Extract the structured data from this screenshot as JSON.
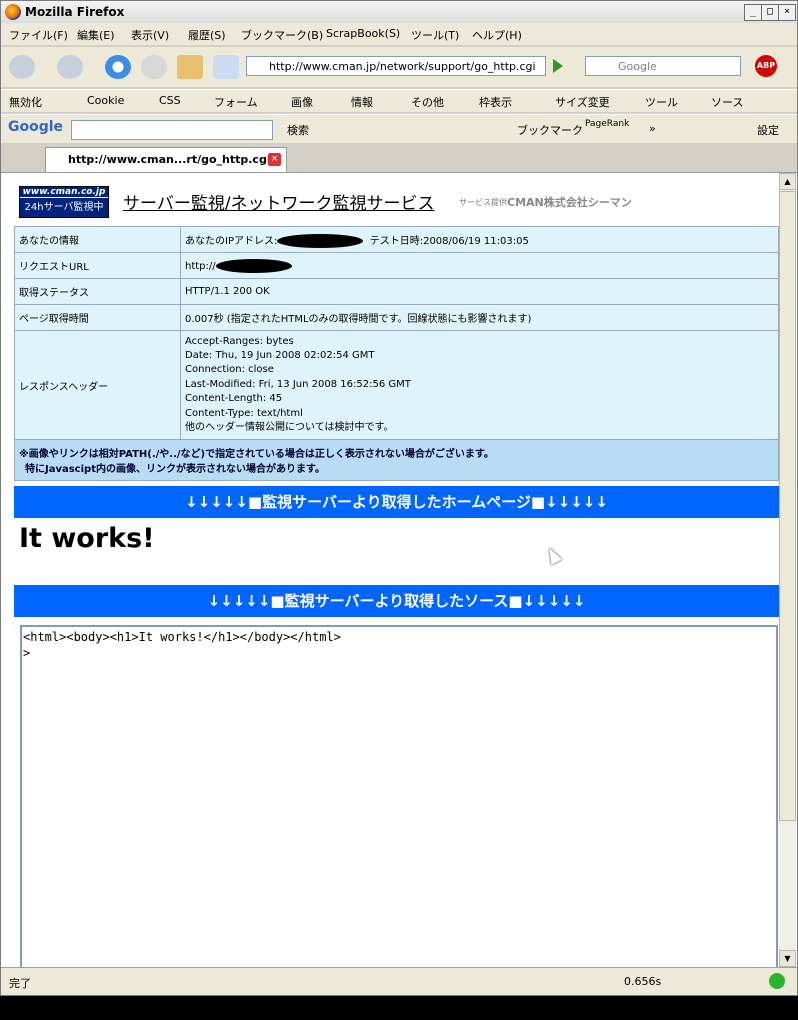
{
  "window": {
    "title": "Mozilla Firefox"
  },
  "menu": [
    "ファイル(F)",
    "編集(E)",
    "表示(V)",
    "履歴(S)",
    "ブックマーク(B)",
    "ScrapBook(S)",
    "ツール(T)",
    "ヘルプ(H)"
  ],
  "nav": {
    "url": "http://www.cman.jp/network/support/go_http.cgi",
    "search_placeholder": "Google"
  },
  "bookmarks": [
    "無効化",
    "Cookie",
    "CSS",
    "フォーム",
    "画像",
    "情報",
    "その他",
    "枠表示",
    "サイズ変更",
    "ツール",
    "ソース"
  ],
  "google_bar": {
    "logo": "Google",
    "search_label": "検索",
    "bookmark_label": "ブックマーク",
    "pagerank_label": "PageRank",
    "more": "»",
    "settings_label": "設定"
  },
  "tab": {
    "title": "http://www.cman...rt/go_http.cgi"
  },
  "page": {
    "logo_top": "www.cman.co.jp",
    "logo_bottom": "24hサーバ監視中",
    "heading": "サーバー監視/ネットワーク監視サービス",
    "provider_prefix": "サービス提供",
    "provider_name": "CMAN株式会社シーマン",
    "rows": {
      "your_info_label": "あなたの情報",
      "ip_label": "あなたのIPアドレス:",
      "test_time": "テスト日時:2008/06/19 11:03:05",
      "request_url_label": "リクエストURL",
      "request_url_prefix": "http://",
      "status_label": "取得ステータス",
      "status_value": "HTTP/1.1 200 OK",
      "time_label": "ページ取得時間",
      "time_value": "0.007秒 (指定されたHTMLのみの取得時間です。回線状態にも影響されます)",
      "headers_label": "レスポンスヘッダー",
      "headers": [
        "Accept-Ranges: bytes",
        "Date: Thu, 19 Jun 2008 02:02:54 GMT",
        "Connection: close",
        "Last-Modified: Fri, 13 Jun 2008 16:52:56 GMT",
        "Content-Length: 45",
        "Content-Type: text/html",
        "他のヘッダー情報公開については検討中です。"
      ]
    },
    "note_line1": "※画像やリンクは相対PATH(./や../など)で指定されている場合は正しく表示されない場合がございます。",
    "note_line2": "特にJavascipt内の画像、リンクが表示されない場合があります。",
    "banner_home": "↓↓↓↓↓■監視サーバーより取得したホームページ■↓↓↓↓↓",
    "fetched_heading": "It works!",
    "banner_source": "↓↓↓↓↓■監視サーバーより取得したソース■↓↓↓↓↓",
    "source_code": "<html><body><h1>It works!</h1></body></html>\n>"
  },
  "status": {
    "text": "完了",
    "timer": "0.656s"
  }
}
